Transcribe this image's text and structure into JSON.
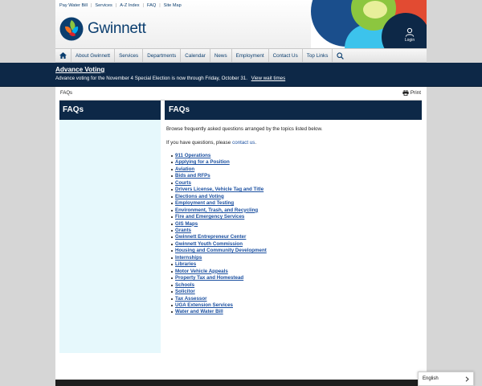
{
  "utility_links": [
    "Pay Water Bill",
    "Services",
    "A-Z Index",
    "FAQ",
    "Site Map"
  ],
  "logo": {
    "text": "Gwinnett"
  },
  "login": {
    "label": "Login"
  },
  "nav": {
    "items": [
      "About Gwinnett",
      "Services",
      "Departments",
      "Calendar",
      "News",
      "Employment",
      "Contact Us",
      "Top Links"
    ]
  },
  "alert": {
    "title": "Advance Voting",
    "message": "Advance voting for the November 4 Special Election is now through Friday, October 31.",
    "link": "View wait times"
  },
  "breadcrumb": "FAQs",
  "print_label": "Print",
  "sidebar": {
    "title": "FAQs"
  },
  "main": {
    "title": "FAQs",
    "intro": "Browse frequently asked questions arranged by the topics listed below.",
    "contact_prefix": "If you have questions, please",
    "contact_link": "contact us",
    "contact_suffix": ".",
    "topics": [
      "911 Operations",
      "Applying for a Position",
      "Aviation",
      "Bids and RFPs",
      "Courts",
      "Drivers License, Vehicle Tag and Title",
      "Elections and Voting",
      "Employment and Testing",
      "Environment, Trash, and Recycling",
      "Fire and Emergency Services",
      "GIS Maps",
      "Grants",
      "Gwinnett Entrepreneur Center",
      "Gwinnett Youth Commission",
      "Housing and Community Development",
      "Internships",
      "Libraries",
      "Motor Vehicle Appeals",
      "Property Tax and Homestead",
      "Schools",
      "Solicitor",
      "Tax Assessor",
      "UGA Extension Services",
      "Water and Water Bill"
    ]
  },
  "language": {
    "selected": "English"
  },
  "colors": {
    "navy": "#0d2847",
    "brand_blue": "#0b3e6f",
    "link": "#1a4fa0",
    "sidebar_bg": "#e6f8fc"
  },
  "icons": [
    "home-icon",
    "search-icon",
    "user-icon",
    "printer-icon",
    "chevron-right-icon"
  ]
}
